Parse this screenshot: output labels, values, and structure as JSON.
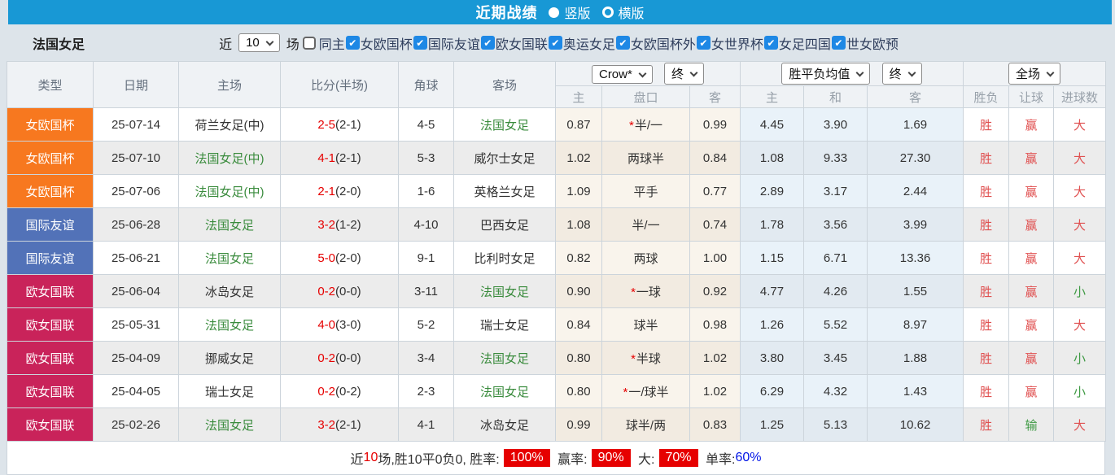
{
  "colors": {
    "accent": "#1898d5",
    "checkbox_blue": "#1e88e5",
    "type_orange": "#f7781f",
    "type_blue": "#5272b8",
    "type_rose": "#c9235a",
    "team_green": "#398b3c",
    "score_red": "#e60000",
    "result_red": "#e05050",
    "result_green": "#3f9a44",
    "badge_red": "#e60000",
    "link_blue": "#0014e6"
  },
  "topbar": {
    "title": "近期战绩",
    "radio_vertical": "竖版",
    "radio_horizontal": "横版"
  },
  "filter": {
    "team": "法国女足",
    "near_label": "近",
    "match_count": "10",
    "games_label": "场",
    "same_home_label": "同主",
    "competitions": [
      "女欧国杯",
      "国际友谊",
      "欧女国联",
      "奥运女足",
      "女欧国杯外",
      "女世界杯",
      "女足四国",
      "世女欧预"
    ]
  },
  "table": {
    "headers": {
      "type": "类型",
      "date": "日期",
      "home": "主场",
      "score": "比分(半场)",
      "corner": "角球",
      "away": "客场",
      "crow_select": "Crow*",
      "crow_time_select": "终",
      "europe_select": "胜平负均值",
      "europe_time_select": "终",
      "scope_select": "全场",
      "sub": [
        "主",
        "盘口",
        "客",
        "主",
        "和",
        "客",
        "胜负",
        "让球",
        "进球数"
      ]
    },
    "rows": [
      {
        "type": "女欧国杯",
        "type_key": "orange",
        "date": "25-07-14",
        "home": "荷兰女足(中)",
        "home_green": false,
        "score": "2-5",
        "half": "(2-1)",
        "corner": "4-5",
        "away": "法国女足",
        "away_green": true,
        "crow_home": "0.87",
        "handicap_star": true,
        "handicap": "半/一",
        "crow_away": "0.99",
        "eu_home": "4.45",
        "eu_draw": "3.90",
        "eu_away": "1.69",
        "result_wl": "胜",
        "result_handicap": "赢",
        "result_goals": "大"
      },
      {
        "type": "女欧国杯",
        "type_key": "orange",
        "date": "25-07-10",
        "home": "法国女足(中)",
        "home_green": true,
        "score": "4-1",
        "half": "(2-1)",
        "corner": "5-3",
        "away": "威尔士女足",
        "away_green": false,
        "crow_home": "1.02",
        "handicap_star": false,
        "handicap": "两球半",
        "crow_away": "0.84",
        "eu_home": "1.08",
        "eu_draw": "9.33",
        "eu_away": "27.30",
        "result_wl": "胜",
        "result_handicap": "赢",
        "result_goals": "大"
      },
      {
        "type": "女欧国杯",
        "type_key": "orange",
        "date": "25-07-06",
        "home": "法国女足(中)",
        "home_green": true,
        "score": "2-1",
        "half": "(2-0)",
        "corner": "1-6",
        "away": "英格兰女足",
        "away_green": false,
        "crow_home": "1.09",
        "handicap_star": false,
        "handicap": "平手",
        "crow_away": "0.77",
        "eu_home": "2.89",
        "eu_draw": "3.17",
        "eu_away": "2.44",
        "result_wl": "胜",
        "result_handicap": "赢",
        "result_goals": "大"
      },
      {
        "type": "国际友谊",
        "type_key": "blue",
        "date": "25-06-28",
        "home": "法国女足",
        "home_green": true,
        "score": "3-2",
        "half": "(1-2)",
        "corner": "4-10",
        "away": "巴西女足",
        "away_green": false,
        "crow_home": "1.08",
        "handicap_star": false,
        "handicap": "半/一",
        "crow_away": "0.74",
        "eu_home": "1.78",
        "eu_draw": "3.56",
        "eu_away": "3.99",
        "result_wl": "胜",
        "result_handicap": "赢",
        "result_goals": "大"
      },
      {
        "type": "国际友谊",
        "type_key": "blue",
        "date": "25-06-21",
        "home": "法国女足",
        "home_green": true,
        "score": "5-0",
        "half": "(2-0)",
        "corner": "9-1",
        "away": "比利时女足",
        "away_green": false,
        "crow_home": "0.82",
        "handicap_star": false,
        "handicap": "两球",
        "crow_away": "1.00",
        "eu_home": "1.15",
        "eu_draw": "6.71",
        "eu_away": "13.36",
        "result_wl": "胜",
        "result_handicap": "赢",
        "result_goals": "大"
      },
      {
        "type": "欧女国联",
        "type_key": "rose",
        "date": "25-06-04",
        "home": "冰岛女足",
        "home_green": false,
        "score": "0-2",
        "half": "(0-0)",
        "corner": "3-11",
        "away": "法国女足",
        "away_green": true,
        "crow_home": "0.90",
        "handicap_star": true,
        "handicap": "一球",
        "crow_away": "0.92",
        "eu_home": "4.77",
        "eu_draw": "4.26",
        "eu_away": "1.55",
        "result_wl": "胜",
        "result_handicap": "赢",
        "result_goals": "小"
      },
      {
        "type": "欧女国联",
        "type_key": "rose",
        "date": "25-05-31",
        "home": "法国女足",
        "home_green": true,
        "score": "4-0",
        "half": "(3-0)",
        "corner": "5-2",
        "away": "瑞士女足",
        "away_green": false,
        "crow_home": "0.84",
        "handicap_star": false,
        "handicap": "球半",
        "crow_away": "0.98",
        "eu_home": "1.26",
        "eu_draw": "5.52",
        "eu_away": "8.97",
        "result_wl": "胜",
        "result_handicap": "赢",
        "result_goals": "大"
      },
      {
        "type": "欧女国联",
        "type_key": "rose",
        "date": "25-04-09",
        "home": "挪威女足",
        "home_green": false,
        "score": "0-2",
        "half": "(0-0)",
        "corner": "3-4",
        "away": "法国女足",
        "away_green": true,
        "crow_home": "0.80",
        "handicap_star": true,
        "handicap": "半球",
        "crow_away": "1.02",
        "eu_home": "3.80",
        "eu_draw": "3.45",
        "eu_away": "1.88",
        "result_wl": "胜",
        "result_handicap": "赢",
        "result_goals": "小"
      },
      {
        "type": "欧女国联",
        "type_key": "rose",
        "date": "25-04-05",
        "home": "瑞士女足",
        "home_green": false,
        "score": "0-2",
        "half": "(0-2)",
        "corner": "2-3",
        "away": "法国女足",
        "away_green": true,
        "crow_home": "0.80",
        "handicap_star": true,
        "handicap": "一/球半",
        "crow_away": "1.02",
        "eu_home": "6.29",
        "eu_draw": "4.32",
        "eu_away": "1.43",
        "result_wl": "胜",
        "result_handicap": "赢",
        "result_goals": "小"
      },
      {
        "type": "欧女国联",
        "type_key": "rose",
        "date": "25-02-26",
        "home": "法国女足",
        "home_green": true,
        "score": "3-2",
        "half": "(2-1)",
        "corner": "4-1",
        "away": "冰岛女足",
        "away_green": false,
        "crow_home": "0.99",
        "handicap_star": false,
        "handicap": "球半/两",
        "crow_away": "0.83",
        "eu_home": "1.25",
        "eu_draw": "5.13",
        "eu_away": "10.62",
        "result_wl": "胜",
        "result_handicap": "输",
        "result_goals": "大"
      }
    ]
  },
  "summary": {
    "segments": [
      {
        "text": "近",
        "style": "dark"
      },
      {
        "text": "10",
        "style": "red"
      },
      {
        "text": "场,胜10平0负0, 胜率:",
        "style": "dark"
      },
      {
        "text": "100%",
        "style": "badge"
      },
      {
        "text": " 赢率:",
        "style": "dark"
      },
      {
        "text": "90%",
        "style": "badge"
      },
      {
        "text": " 大:",
        "style": "dark"
      },
      {
        "text": "70%",
        "style": "badge"
      },
      {
        "text": " 单率:",
        "style": "dark"
      },
      {
        "text": "60%",
        "style": "blue"
      }
    ]
  }
}
